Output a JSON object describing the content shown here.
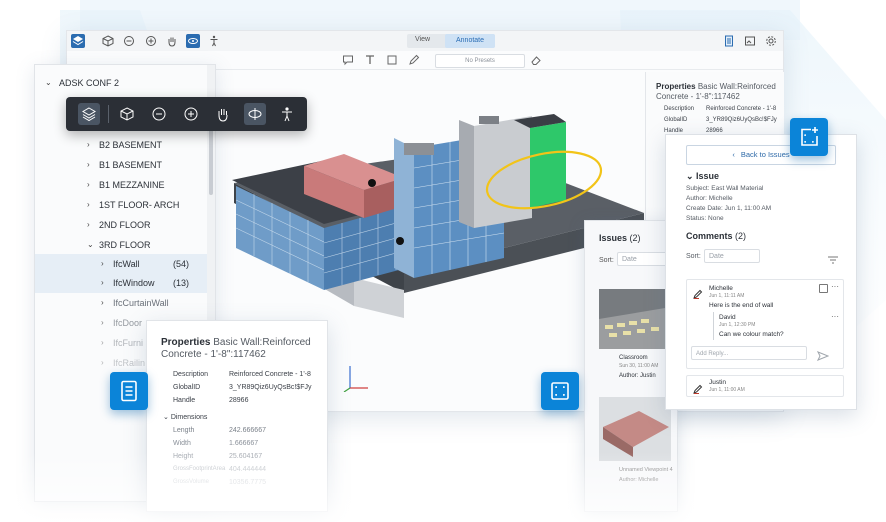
{
  "topbar": {
    "view_tab": "View",
    "annotate_tab": "Annotate",
    "presets": "No Presets"
  },
  "tree": {
    "root": "ADSK CONF 2",
    "items": [
      {
        "label": "B2 BASEMENT",
        "count": ""
      },
      {
        "label": "B1 BASEMENT",
        "count": ""
      },
      {
        "label": "B1 MEZZANINE",
        "count": ""
      },
      {
        "label": "1ST FLOOR- ARCH",
        "count": ""
      },
      {
        "label": "2ND FLOOR",
        "count": ""
      },
      {
        "label": "3RD FLOOR",
        "count": ""
      },
      {
        "label": "IfcWall",
        "count": "(54)"
      },
      {
        "label": "IfcWindow",
        "count": "(13)"
      },
      {
        "label": "IfcCurtainWall",
        "count": ""
      },
      {
        "label": "IfcDoor",
        "count": ""
      },
      {
        "label": "IfcFurni",
        "count": ""
      },
      {
        "label": "IfcRailin",
        "count": ""
      }
    ]
  },
  "props_right": {
    "title_bold": "Properties",
    "title_rest": "Basic Wall:Reinforced Concrete - 1'-8\":117462",
    "rows": [
      {
        "k": "Description",
        "v": "Reinforced Concrete - 1'-8"
      },
      {
        "k": "GlobalID",
        "v": "3_YR89Qiz6UyQsBc!$FJy"
      },
      {
        "k": "Handle",
        "v": "28966"
      }
    ]
  },
  "issue_panel": {
    "back": "Back to Issues",
    "heading": "Issue",
    "subject": "Subject: East Wall Material",
    "author": "Author: Michelle",
    "create_date": "Create Date: Jun 1, 11:00 AM",
    "status": "Status: None",
    "comments_heading": "Comments",
    "comments_count": "(2)",
    "sort_label": "Sort:",
    "sort_value": "Date",
    "comment1_author": "Michelle",
    "comment1_time": "Jun 1, 11:11 AM",
    "comment1_text": "Here is the end of wall",
    "reply_author": "David",
    "reply_time": "Jun 1, 12:30 PM",
    "reply_text": "Can we colour match?",
    "reply_placeholder": "Add Reply...",
    "comment2_author": "Justin",
    "comment2_time": "Jun 1, 11:00 AM"
  },
  "issues_list": {
    "heading": "Issues",
    "count": "(2)",
    "sort_label": "Sort:",
    "sort_value": "Date",
    "item1_title": "Classroom",
    "item1_date": "Sun 30, 11:00 AM",
    "item1_author": "Author: Justin",
    "item2_title": "Unnamed Viewpoint 4",
    "item2_author": "Author: Michelle"
  },
  "props_bottom": {
    "title_bold": "Properties",
    "title_rest": "Basic Wall:Reinforced Concrete - 1'-8\":117462",
    "rows": [
      {
        "k": "Description",
        "v": "Reinforced Concrete - 1'-8"
      },
      {
        "k": "GlobalID",
        "v": "3_YR89Qiz6UyQsBc!$FJy"
      },
      {
        "k": "Handle",
        "v": "28966"
      }
    ],
    "dimensions_label": "Dimensions",
    "dims": [
      {
        "k": "Length",
        "v": "242.666667"
      },
      {
        "k": "Width",
        "v": "1.666667"
      },
      {
        "k": "Height",
        "v": "25.604167"
      },
      {
        "k": "GrossFootprintArea",
        "v": "404.444444"
      },
      {
        "k": "GrossVolume",
        "v": "10356.7775"
      }
    ]
  },
  "colors": {
    "accent": "#0b84d8",
    "dark_toolbar": "#2b2f36",
    "annotation": "#f2c418",
    "wall_green": "#2ec86a",
    "brick": "#c97a7a"
  }
}
